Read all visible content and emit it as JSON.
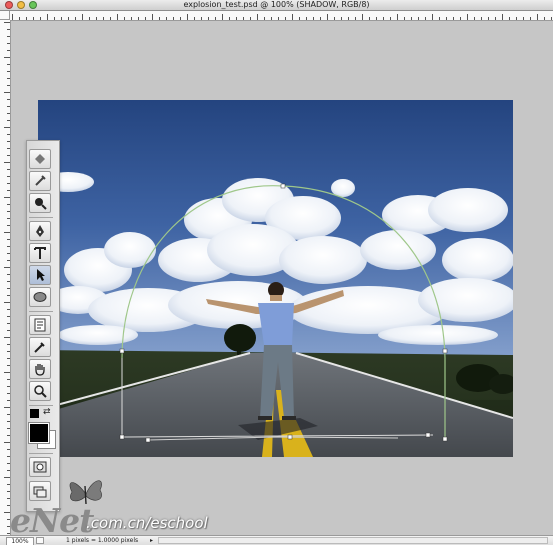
{
  "window": {
    "title": "explosion_test.psd @ 100% (SHADOW, RGB/8)"
  },
  "status_bar": {
    "zoom": "100%",
    "doc_info": "1 pixels = 1.0000 pixels"
  },
  "watermark": {
    "brand": "eNet",
    "url": ".com.cn/eschool"
  },
  "icons": {
    "tools": [
      "bucket-tool-icon",
      "magic-tool-icon",
      "burn-tool-icon",
      "pen-tool-icon",
      "type-tool-icon",
      "path-selection-tool-icon",
      "ellipse-tool-icon",
      "notes-tool-icon",
      "eyedropper-tool-icon",
      "hand-tool-icon",
      "zoom-tool-icon",
      "swap-colors-icon",
      "quick-mask-icon",
      "screen-mode-icon"
    ]
  },
  "colors": {
    "foreground": "#000000",
    "background": "#ffffff",
    "canvas_bg": "#c6c6c6"
  }
}
